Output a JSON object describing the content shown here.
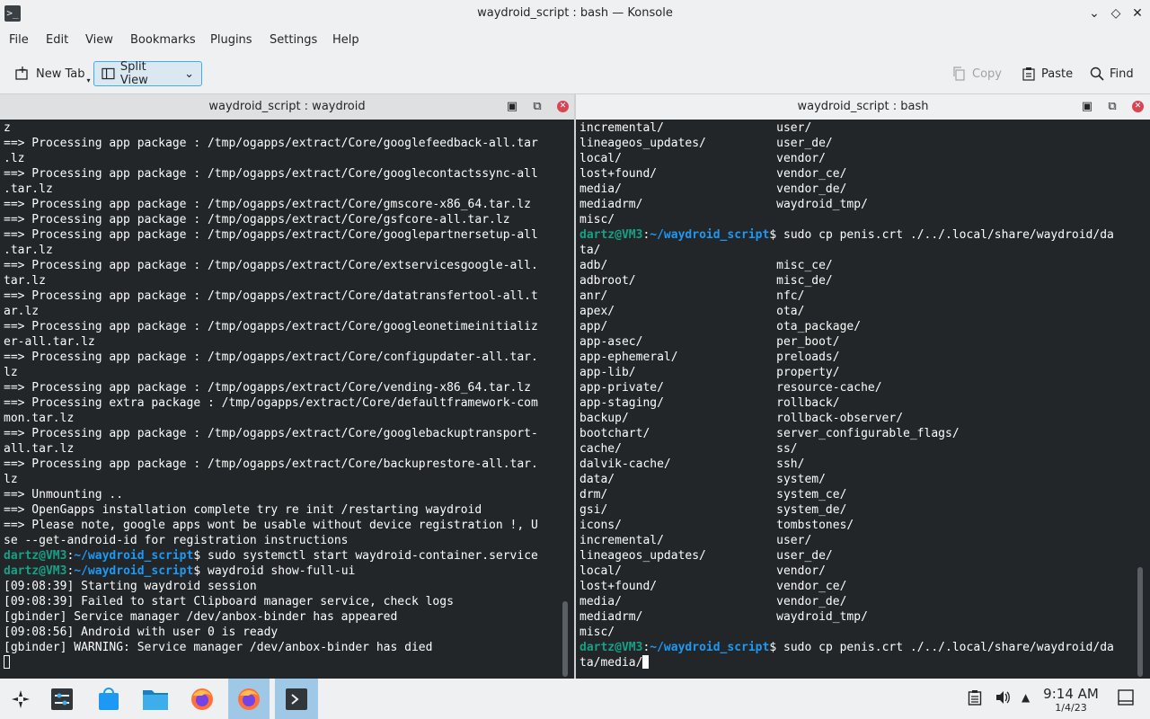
{
  "window": {
    "title": "waydroid_script : bash — Konsole",
    "app_icon": ">_"
  },
  "menu": [
    "File",
    "Edit",
    "View",
    "Bookmarks",
    "Plugins",
    "Settings",
    "Help"
  ],
  "toolbar": {
    "new_tab": "New Tab",
    "split_view": "Split View",
    "copy": "Copy",
    "paste": "Paste",
    "find": "Find"
  },
  "left_pane": {
    "title": "waydroid_script : waydroid",
    "lines": [
      {
        "t": "z"
      },
      {
        "t": "==> Processing app package : /tmp/ogapps/extract/Core/googlefeedback-all.tar"
      },
      {
        "t": ".lz"
      },
      {
        "t": "==> Processing app package : /tmp/ogapps/extract/Core/googlecontactssync-all"
      },
      {
        "t": ".tar.lz"
      },
      {
        "t": "==> Processing app package : /tmp/ogapps/extract/Core/gmscore-x86_64.tar.lz"
      },
      {
        "t": "==> Processing app package : /tmp/ogapps/extract/Core/gsfcore-all.tar.lz"
      },
      {
        "t": "==> Processing app package : /tmp/ogapps/extract/Core/googlepartnersetup-all"
      },
      {
        "t": ".tar.lz"
      },
      {
        "t": "==> Processing app package : /tmp/ogapps/extract/Core/extservicesgoogle-all."
      },
      {
        "t": "tar.lz"
      },
      {
        "t": "==> Processing app package : /tmp/ogapps/extract/Core/datatransfertool-all.t"
      },
      {
        "t": "ar.lz"
      },
      {
        "t": "==> Processing app package : /tmp/ogapps/extract/Core/googleonetimeinitializ"
      },
      {
        "t": "er-all.tar.lz"
      },
      {
        "t": "==> Processing app package : /tmp/ogapps/extract/Core/configupdater-all.tar."
      },
      {
        "t": "lz"
      },
      {
        "t": "==> Processing app package : /tmp/ogapps/extract/Core/vending-x86_64.tar.lz"
      },
      {
        "t": "==> Processing extra package : /tmp/ogapps/extract/Core/defaultframework-com"
      },
      {
        "t": "mon.tar.lz"
      },
      {
        "t": "==> Processing app package : /tmp/ogapps/extract/Core/googlebackuptransport-"
      },
      {
        "t": "all.tar.lz"
      },
      {
        "t": "==> Processing app package : /tmp/ogapps/extract/Core/backuprestore-all.tar."
      },
      {
        "t": "lz"
      },
      {
        "t": "==> Unmounting .."
      },
      {
        "t": "==> OpenGapps installation complete try re init /restarting waydroid"
      },
      {
        "t": "==> Please note, google apps wont be usable without device registration !, U"
      },
      {
        "t": "se --get-android-id for registration instructions"
      },
      {
        "u": "dartz@VM3",
        "p": "~/waydroid_script",
        "t": "$ sudo systemctl start waydroid-container.service"
      },
      {
        "u": "dartz@VM3",
        "p": "~/waydroid_script",
        "t": "$ waydroid show-full-ui"
      },
      {
        "t": "[09:08:39] Starting waydroid session"
      },
      {
        "t": "[09:08:39] Failed to start Clipboard manager service, check logs"
      },
      {
        "t": "[gbinder] Service manager /dev/anbox-binder has appeared"
      },
      {
        "t": "[09:08:56] Android with user 0 is ready"
      },
      {
        "t": "[gbinder] WARNING: Service manager /dev/anbox-binder has died"
      },
      {
        "t": "",
        "cursor": "hollow"
      }
    ]
  },
  "right_pane": {
    "title": "waydroid_script : bash",
    "lines": [
      {
        "t": "incremental/                user/"
      },
      {
        "t": "lineageos_updates/          user_de/"
      },
      {
        "t": "local/                      vendor/"
      },
      {
        "t": "lost+found/                 vendor_ce/"
      },
      {
        "t": "media/                      vendor_de/"
      },
      {
        "t": "mediadrm/                   waydroid_tmp/"
      },
      {
        "t": "misc/"
      },
      {
        "u": "dartz@VM3",
        "p": "~/waydroid_script",
        "t": "$ sudo cp penis.crt ./../.local/share/waydroid/da"
      },
      {
        "t": "ta/"
      },
      {
        "t": "adb/                        misc_ce/"
      },
      {
        "t": "adbroot/                    misc_de/"
      },
      {
        "t": "anr/                        nfc/"
      },
      {
        "t": "apex/                       ota/"
      },
      {
        "t": "app/                        ota_package/"
      },
      {
        "t": "app-asec/                   per_boot/"
      },
      {
        "t": "app-ephemeral/              preloads/"
      },
      {
        "t": "app-lib/                    property/"
      },
      {
        "t": "app-private/                resource-cache/"
      },
      {
        "t": "app-staging/                rollback/"
      },
      {
        "t": "backup/                     rollback-observer/"
      },
      {
        "t": "bootchart/                  server_configurable_flags/"
      },
      {
        "t": "cache/                      ss/"
      },
      {
        "t": "dalvik-cache/               ssh/"
      },
      {
        "t": "data/                       system/"
      },
      {
        "t": "drm/                        system_ce/"
      },
      {
        "t": "gsi/                        system_de/"
      },
      {
        "t": "icons/                      tombstones/"
      },
      {
        "t": "incremental/                user/"
      },
      {
        "t": "lineageos_updates/          user_de/"
      },
      {
        "t": "local/                      vendor/"
      },
      {
        "t": "lost+found/                 vendor_ce/"
      },
      {
        "t": "media/                      vendor_de/"
      },
      {
        "t": "mediadrm/                   waydroid_tmp/"
      },
      {
        "t": "misc/"
      },
      {
        "u": "dartz@VM3",
        "p": "~/waydroid_script",
        "t": "$ sudo cp penis.crt ./../.local/share/waydroid/da"
      },
      {
        "t": "ta/media/",
        "cursor": "solid"
      }
    ]
  },
  "taskbar": {
    "items": [
      "app-launcher-icon",
      "system-settings-icon",
      "discover-icon",
      "dolphin-icon",
      "firefox-icon",
      "firefox-icon",
      "konsole-icon"
    ],
    "clock_time": "9:14 AM",
    "clock_date": "1/4/23"
  },
  "colors": {
    "user": "#16a085",
    "path": "#1d99f3",
    "terminal_bg": "#232629",
    "terminal_fg": "#fcfcfc",
    "accent": "#3daee9"
  }
}
